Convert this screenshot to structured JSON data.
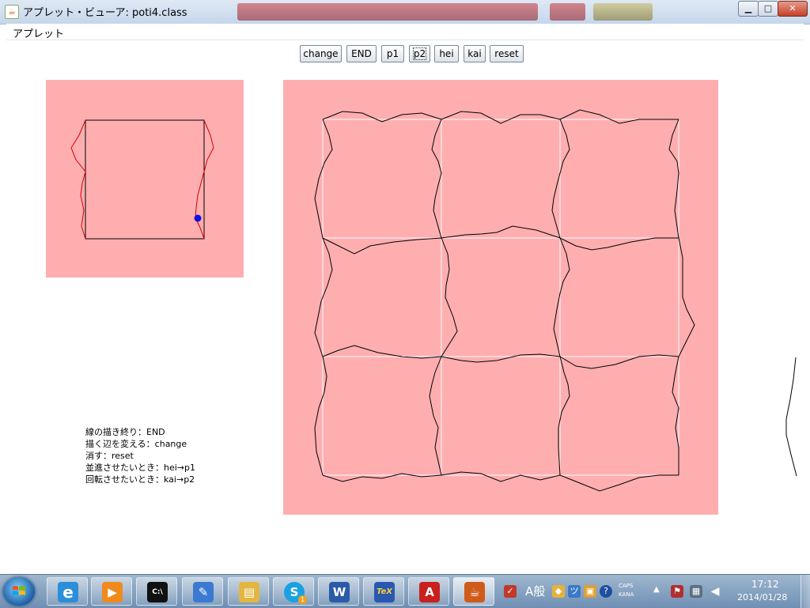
{
  "window": {
    "title": "アプレット・ビューア: poti4.class",
    "controls": {
      "minimize": "▁",
      "maximize": "□",
      "close": "✕"
    }
  },
  "menu": {
    "applet": "アプレット"
  },
  "toolbar": {
    "buttons": [
      {
        "id": "change",
        "label": "change"
      },
      {
        "id": "end",
        "label": "END"
      },
      {
        "id": "p1",
        "label": "p1"
      },
      {
        "id": "p2",
        "label": "p2"
      },
      {
        "id": "hei",
        "label": "hei"
      },
      {
        "id": "kai",
        "label": "kai"
      },
      {
        "id": "reset",
        "label": "reset"
      }
    ],
    "focused": "p2"
  },
  "colors": {
    "canvas_bg": "#ffaeb0",
    "grid_line": "#ffffff",
    "curve": "#000000",
    "edited_edge": "#d40000",
    "control_point": "#1010e0"
  },
  "instructions": {
    "line1": "線の描き終り：END",
    "line2": "描く辺を変える：change",
    "line3": "消す：reset",
    "line4": "並進させたいとき：hei→p1",
    "line5": "回転させたいとき：kai→p2"
  },
  "taskbar": {
    "apps": [
      {
        "name": "internet-explorer-icon",
        "glyph": "e",
        "color": "#2a8fd8"
      },
      {
        "name": "media-player-icon",
        "glyph": "▶",
        "color": "#f08a1c"
      },
      {
        "name": "command-prompt-icon",
        "glyph": "C:\\",
        "color": "#111111"
      },
      {
        "name": "paint-icon",
        "glyph": "✎",
        "color": "#3a7ad0"
      },
      {
        "name": "explorer-icon",
        "glyph": "▤",
        "color": "#e2b640"
      },
      {
        "name": "skype-icon",
        "glyph": "S",
        "color": "#1aa1e1"
      },
      {
        "name": "word-icon",
        "glyph": "W",
        "color": "#2b5aa8"
      },
      {
        "name": "tex-icon",
        "glyph": "TeX",
        "color": "#2a57b0"
      },
      {
        "name": "acrobat-icon",
        "glyph": "A",
        "color": "#c8201e"
      },
      {
        "name": "java-icon",
        "glyph": "☕",
        "color": "#d05a1a"
      }
    ],
    "skype_badge": "1",
    "ime": {
      "mode": "A",
      "kana": "般",
      "caps": "CAPS",
      "kana_label": "KANA"
    },
    "clock": {
      "time": "17:12",
      "date": "2014/01/28"
    }
  }
}
